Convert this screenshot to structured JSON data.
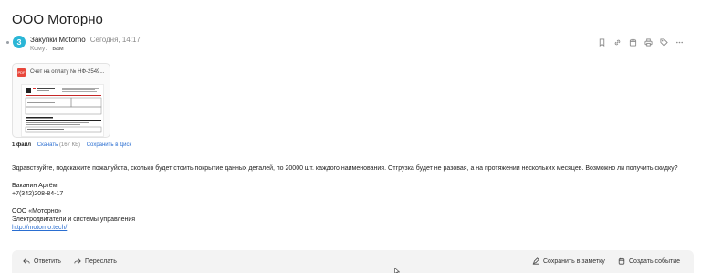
{
  "message": {
    "subject": "ООО Моторно",
    "sender_initial": "З",
    "sender_name": "Закупки Motorno",
    "date": "Сегодня, 14:17",
    "to_label": "Кому:",
    "to_value": "вам"
  },
  "toolbar_icons": [
    "bookmark-icon",
    "link-icon",
    "calendar-icon",
    "print-icon",
    "tag-icon",
    "more-icon"
  ],
  "attachment": {
    "file_badge": "PDF",
    "file_name": "Счет на оплату № НФ-2549...",
    "count_label": "1 файл",
    "download_label": "Скачать",
    "size": "(167 КБ)",
    "save_to_disk_label": "Сохранить в Диск"
  },
  "body": {
    "greeting": "Здравствуйте, подскажите пожалуйста, сколько будет стоить покрытие данных деталей, по 20000 шт. каждого наименования. Отгрузка будет не разовая, а на протяжении нескольких месяцев. Возможно ли получить скидку?",
    "sig_name": "Баканин Артём",
    "sig_phone": "+7(342)208-84-17",
    "company": "ООО «Моторно»",
    "company_desc": "Электродвигатели и системы управления",
    "website": "http://motorno.tech/"
  },
  "bottom_bar": {
    "reply_label": "Ответить",
    "forward_label": "Переслать",
    "save_note_label": "Сохранить в заметку",
    "create_event_label": "Создать событие"
  },
  "colors": {
    "avatar": "#2bb6d6",
    "link": "#2a6ed1",
    "pdf": "#e8473b"
  }
}
